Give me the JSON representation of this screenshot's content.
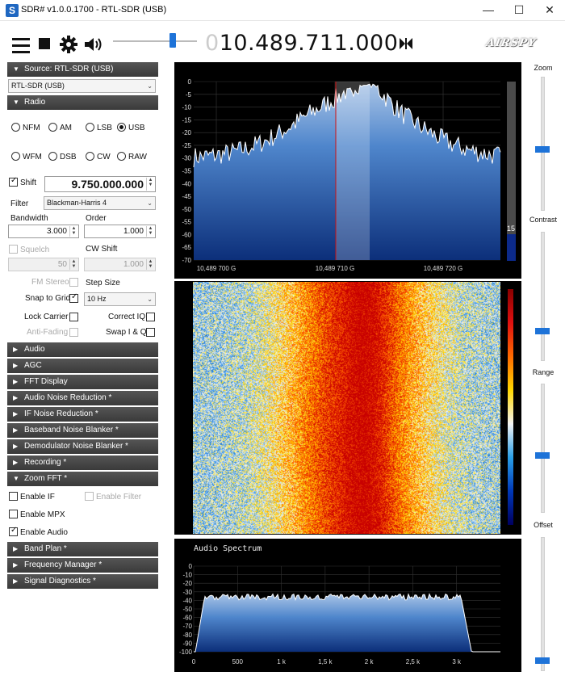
{
  "window": {
    "title": "SDR# v1.0.0.1700 - RTL-SDR (USB)",
    "app_icon": "sdrsharp-icon",
    "minimize": "—",
    "maximize": "☐",
    "close": "✕"
  },
  "toolbar": {
    "frequency_leading": "0",
    "frequency": "10.489.711.000",
    "logo": "AIRSPY",
    "volume_fraction": 0.72
  },
  "source": {
    "header": "Source: RTL-SDR (USB)",
    "device": "RTL-SDR (USB)"
  },
  "radio": {
    "header": "Radio",
    "modes": [
      "NFM",
      "AM",
      "LSB",
      "USB",
      "WFM",
      "DSB",
      "CW",
      "RAW"
    ],
    "selected_mode": "USB",
    "shift_label": "Shift",
    "shift_value": "9.750.000.000",
    "filter_label": "Filter",
    "filter_value": "Blackman-Harris 4",
    "bandwidth_label": "Bandwidth",
    "bandwidth_value": "3.000",
    "order_label": "Order",
    "order_value": "1.000",
    "squelch_label": "Squelch",
    "squelch_value": "50",
    "cw_shift_label": "CW Shift",
    "cw_shift_value": "1.000",
    "fm_stereo_label": "FM Stereo",
    "step_size_label": "Step Size",
    "snap_label": "Snap to Grid",
    "step_value": "10 Hz",
    "lock_carrier_label": "Lock Carrier",
    "correct_iq_label": "Correct IQ",
    "anti_fading_label": "Anti-Fading",
    "swap_iq_label": "Swap I & Q"
  },
  "plugins": [
    "Audio",
    "AGC",
    "FFT Display",
    "Audio Noise Reduction *",
    "IF Noise Reduction *",
    "Baseband Noise Blanker *",
    "Demodulator Noise Blanker *",
    "Recording *"
  ],
  "zoom_fft": {
    "header": "Zoom FFT *",
    "enable_if": "Enable IF",
    "enable_filter": "Enable Filter",
    "enable_mpx": "Enable MPX",
    "enable_audio": "Enable Audio"
  },
  "plugins_bottom": [
    "Band Plan *",
    "Frequency Manager *",
    "Signal Diagnostics *"
  ],
  "right_panel": {
    "zoom_label": "Zoom",
    "contrast_label": "Contrast",
    "range_label": "Range",
    "offset_label": "Offset",
    "zoom_level": 0.66,
    "contrast_level": 0.4,
    "range_level": 0.47,
    "offset_level": 0.02
  },
  "colors": {
    "accent": "#1e73d8",
    "panel_header": "#454545",
    "spectrum_fill": "#1f5fb5",
    "vfo_line": "#d01010"
  },
  "chart_data": [
    {
      "type": "area",
      "name": "spectrum",
      "y_ticks": [
        "0",
        "-5",
        "-10",
        "-15",
        "-20",
        "-25",
        "-30",
        "-35",
        "-40",
        "-45",
        "-50",
        "-55",
        "-60",
        "-65",
        "-70"
      ],
      "ylim": [
        -70,
        0
      ],
      "x_ticks": [
        "10,489 700 G",
        "10,489 710 G",
        "10,489 720 G"
      ],
      "level_label": "15",
      "grid": true
    },
    {
      "type": "heatmap",
      "name": "waterfall"
    },
    {
      "type": "area",
      "name": "audio_spectrum",
      "title": "Audio Spectrum",
      "y_ticks": [
        "0",
        "-10",
        "-20",
        "-30",
        "-40",
        "-50",
        "-60",
        "-70",
        "-80",
        "-90",
        "-100"
      ],
      "ylim": [
        -100,
        0
      ],
      "x_ticks": [
        "0",
        "500",
        "1 k",
        "1,5 k",
        "2 k",
        "2,5 k",
        "3 k"
      ],
      "grid": true
    }
  ]
}
